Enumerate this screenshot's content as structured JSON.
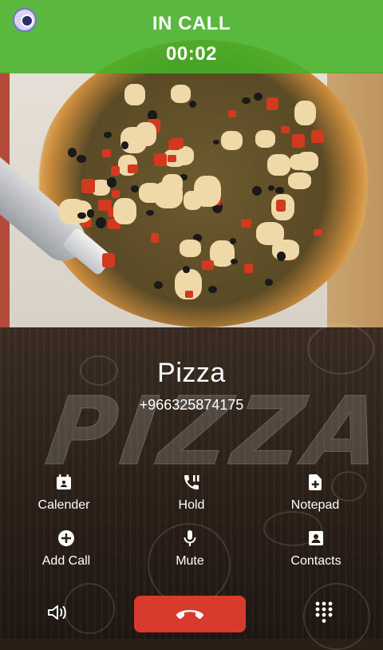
{
  "header": {
    "status": "IN CALL",
    "timer": "00:02",
    "color": "#46b228"
  },
  "contact": {
    "name": "Pizza",
    "number": "+966325874175"
  },
  "background_word": "PIZZA",
  "actions": [
    {
      "label": "Calender",
      "icon": "calendar-add-icon"
    },
    {
      "label": "Hold",
      "icon": "phone-hold-icon"
    },
    {
      "label": "Notepad",
      "icon": "note-add-icon"
    },
    {
      "label": "Add Call",
      "icon": "add-circle-icon"
    },
    {
      "label": "Mute",
      "icon": "microphone-icon"
    },
    {
      "label": "Contacts",
      "icon": "contact-card-icon"
    }
  ],
  "bottom_controls": {
    "speaker_icon": "speaker-icon",
    "end_call_icon": "phone-hangup-icon",
    "end_call_color": "#d73b2d",
    "dialpad_icon": "dialpad-icon"
  }
}
